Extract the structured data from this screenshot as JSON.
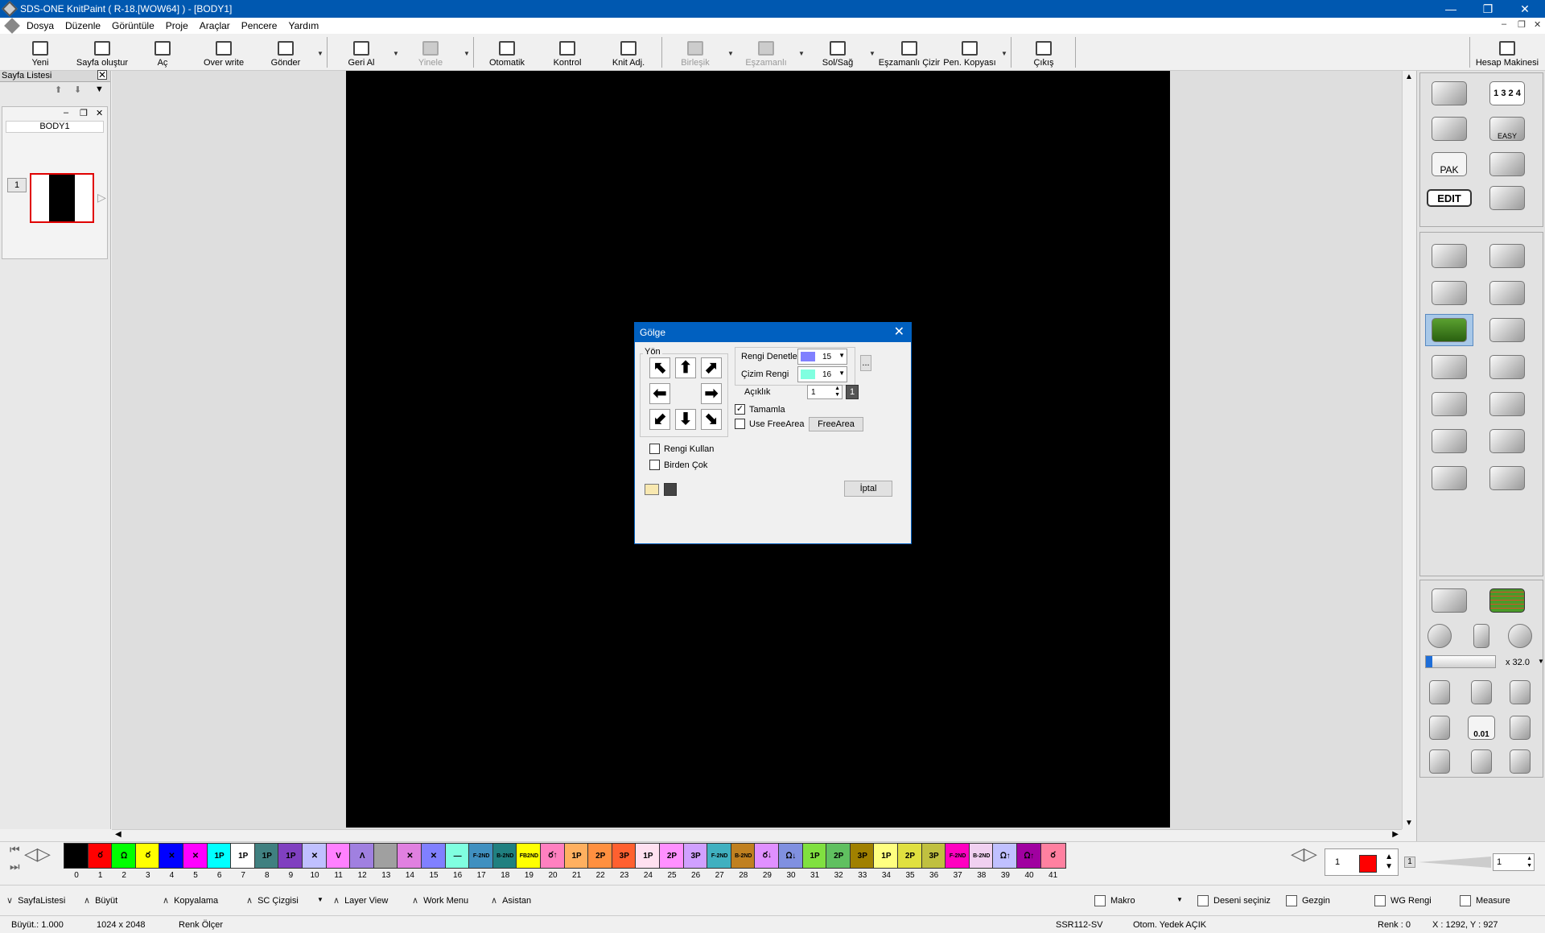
{
  "window": {
    "title": "SDS-ONE KnitPaint ( R-18.[WOW64] ) - [BODY1]"
  },
  "menu": [
    "Dosya",
    "Düzenle",
    "Görüntüle",
    "Proje",
    "Araçlar",
    "Pencere",
    "Yardım"
  ],
  "toolbar": {
    "new": "Yeni",
    "create_page": "Sayfa oluştur",
    "open": "Aç",
    "overwrite": "Over write",
    "send": "Gönder",
    "undo": "Geri Al",
    "redo": "Yinele",
    "auto": "Otomatik",
    "control": "Kontrol",
    "knit_adj": "Knit Adj.",
    "merge": "Birleşik",
    "simultaneous": "Eşzamanlı",
    "left_right": "Sol/Sağ",
    "sim_draw": "Eşzamanlı Çizir",
    "pen_copy": "Pen. Kopyası",
    "exit": "Çıkış",
    "calculator": "Hesap Makinesi"
  },
  "page_list": {
    "title": "Sayfa Listesi",
    "body": "BODY1",
    "page_number": "1"
  },
  "dialog": {
    "title": "Gölge",
    "direction_label": "Yön",
    "check_color_label": "Rengi Denetle",
    "check_color_value": "15",
    "check_color_hex": "#8080ff",
    "draw_color_label": "Çizim Rengi",
    "draw_color_value": "16",
    "draw_color_hex": "#80ffe0",
    "width_label": "Açıklık",
    "width_value": "1",
    "width_badge": "1",
    "complete_label": "Tamamla",
    "complete_checked": "✓",
    "use_freearea_label": "Use FreeArea",
    "freearea_button": "FreeArea",
    "use_color_label": "Rengi Kullan",
    "multiple_label": "Birden Çok",
    "cancel_button": "İptal",
    "more_button": "..."
  },
  "right_panel": {
    "zoom": "x 32.0",
    "step": "0.01",
    "edit_label": "EDIT",
    "pak_label": "PAK",
    "easy_label": "EASY",
    "numbers_label": "1 3 2 4"
  },
  "palette": {
    "colors": [
      {
        "n": "0",
        "hex": "#000000",
        "t": ""
      },
      {
        "n": "1",
        "hex": "#ff0000",
        "t": "ర"
      },
      {
        "n": "2",
        "hex": "#00ff00",
        "t": "ᘯ"
      },
      {
        "n": "3",
        "hex": "#ffff00",
        "t": "ర"
      },
      {
        "n": "4",
        "hex": "#0000ff",
        "t": "✕"
      },
      {
        "n": "5",
        "hex": "#ff00ff",
        "t": "✕"
      },
      {
        "n": "6",
        "hex": "#00ffff",
        "t": "1P"
      },
      {
        "n": "7",
        "hex": "#ffffff",
        "t": "1P"
      },
      {
        "n": "8",
        "hex": "#408080",
        "t": "1P"
      },
      {
        "n": "9",
        "hex": "#8040c0",
        "t": "1P"
      },
      {
        "n": "10",
        "hex": "#c0c0ff",
        "t": "✕"
      },
      {
        "n": "11",
        "hex": "#ff80ff",
        "t": "V"
      },
      {
        "n": "12",
        "hex": "#a080e0",
        "t": "Λ"
      },
      {
        "n": "13",
        "hex": "#a0a0a0",
        "t": ""
      },
      {
        "n": "14",
        "hex": "#e080e0",
        "t": "✕"
      },
      {
        "n": "15",
        "hex": "#8080ff",
        "t": "✕"
      },
      {
        "n": "16",
        "hex": "#80ffe0",
        "t": "—"
      },
      {
        "n": "17",
        "hex": "#4090c0",
        "t": "F-2ND"
      },
      {
        "n": "18",
        "hex": "#208080",
        "t": "B-2ND"
      },
      {
        "n": "19",
        "hex": "#ffff00",
        "t": "FB2ND"
      },
      {
        "n": "20",
        "hex": "#ff80c0",
        "t": "ర↑"
      },
      {
        "n": "21",
        "hex": "#ffb060",
        "t": "1P"
      },
      {
        "n": "22",
        "hex": "#ff9040",
        "t": "2P"
      },
      {
        "n": "23",
        "hex": "#ff6030",
        "t": "3P"
      },
      {
        "n": "24",
        "hex": "#ffe0f0",
        "t": "1P"
      },
      {
        "n": "25",
        "hex": "#ff90ff",
        "t": "2P"
      },
      {
        "n": "26",
        "hex": "#d0a0ff",
        "t": "3P"
      },
      {
        "n": "27",
        "hex": "#40b0c0",
        "t": "F-2ND"
      },
      {
        "n": "28",
        "hex": "#c08020",
        "t": "B-2ND"
      },
      {
        "n": "29",
        "hex": "#e090ff",
        "t": "ర↓"
      },
      {
        "n": "30",
        "hex": "#8090e0",
        "t": "ᘯ↓"
      },
      {
        "n": "31",
        "hex": "#80e040",
        "t": "1P"
      },
      {
        "n": "32",
        "hex": "#60c060",
        "t": "2P"
      },
      {
        "n": "33",
        "hex": "#a08000",
        "t": "3P"
      },
      {
        "n": "34",
        "hex": "#ffff80",
        "t": "1P"
      },
      {
        "n": "35",
        "hex": "#e0e040",
        "t": "2P"
      },
      {
        "n": "36",
        "hex": "#c0c040",
        "t": "3P"
      },
      {
        "n": "37",
        "hex": "#ff00c0",
        "t": "F-2ND"
      },
      {
        "n": "38",
        "hex": "#f0d0f0",
        "t": "B-2ND"
      },
      {
        "n": "39",
        "hex": "#c0c0ff",
        "t": "ᘯ↑"
      },
      {
        "n": "40",
        "hex": "#a000a0",
        "t": "ᘯ↑"
      },
      {
        "n": "41",
        "hex": "#ff80a0",
        "t": "ర"
      }
    ],
    "selected_value": "1",
    "selected_hex": "#ff0000",
    "slider_value": "1",
    "slider_index": "1"
  },
  "bottom_bar": {
    "page_list": "SayfaListesi",
    "enlarge": "Büyüt",
    "copy": "Kopyalama",
    "sc_line": "SC Çizgisi",
    "layer_view": "Layer View",
    "work_menu": "Work Menu",
    "assistant": "Asistan",
    "macro": "Makro",
    "select_pattern": "Deseni seçiniz",
    "browser": "Gezgin",
    "wg_color": "WG Rengi",
    "measure": "Measure"
  },
  "status": {
    "zoom": "Büyüt.: 1.000",
    "size": "1024 x 2048",
    "color_meter": "Renk Ölçer",
    "machine": "SSR112-SV",
    "autosave": "Otom. Yedek AÇIK",
    "color": "Renk :  0",
    "coords": "X : 1292, Y : 927"
  }
}
